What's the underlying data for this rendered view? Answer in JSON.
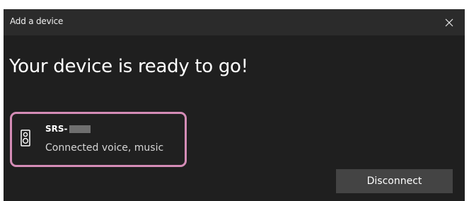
{
  "window": {
    "title": "Add a device",
    "close_icon": "close-icon"
  },
  "main": {
    "heading": "Your device is ready to go!"
  },
  "device": {
    "icon": "speaker-icon",
    "name": "SRS-",
    "status": "Connected voice, music",
    "highlight_color": "#d48cb6"
  },
  "actions": {
    "disconnect_label": "Disconnect"
  }
}
